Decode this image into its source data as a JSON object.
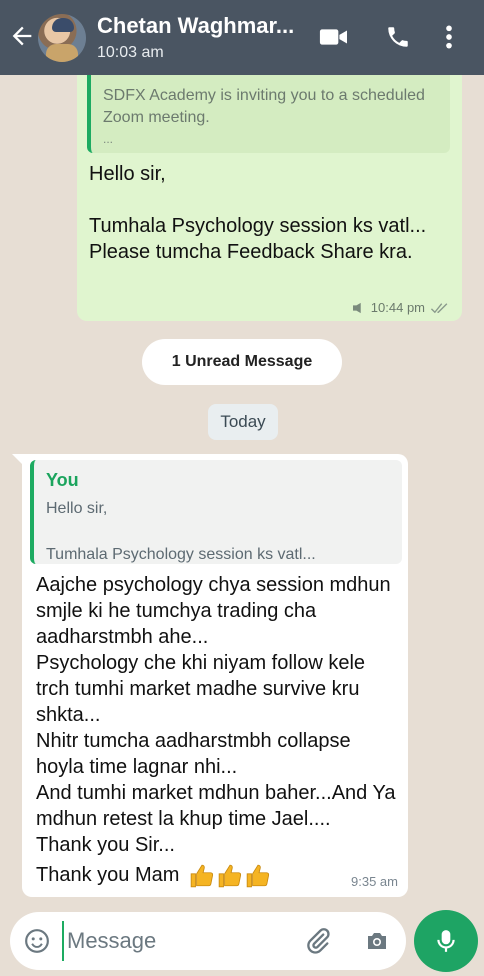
{
  "header": {
    "contact_name": "Chetan Waghmar...",
    "status": "10:03 am",
    "colors": {
      "bar": "#4a5562"
    },
    "icons": [
      "back-arrow-icon",
      "video-call-icon",
      "phone-icon",
      "more-options-icon"
    ]
  },
  "outgoing": {
    "quoted_text": "SDFX Academy is inviting you to a scheduled Zoom meeting.",
    "quoted_more": "...",
    "lines": [
      "Hello sir,",
      "",
      "Tumhala Psychology session ks vatl...",
      "Please tumcha Feedback Share kra."
    ],
    "time": "10:44 pm",
    "color": "#e0f5cf"
  },
  "unread_banner": "1 Unread Message",
  "date_divider": "Today",
  "incoming": {
    "quote": {
      "author": "You",
      "line1": "Hello sir,",
      "line2": "Tumhala Psychology session ks vatl..."
    },
    "lines": [
      "Aajche psychology chya session mdhun smjle ki he tumchya trading cha aadharstmbh ahe...",
      "Psychology che khi niyam follow kele trch tumhi market madhe survive kru shkta...",
      "Nhitr tumcha aadharstmbh collapse hoyla time lagnar nhi...",
      "And tumhi market mdhun baher...And Ya mdhun retest la khup time Jael....",
      "Thank you Sir..."
    ],
    "last_line": "Thank you Mam",
    "thumbs_count": 3,
    "time": "9:35 am"
  },
  "composer": {
    "placeholder": "Message",
    "icons": [
      "emoji-icon",
      "attach-icon",
      "camera-icon",
      "mic-icon"
    ],
    "accent": "#1ea464"
  }
}
